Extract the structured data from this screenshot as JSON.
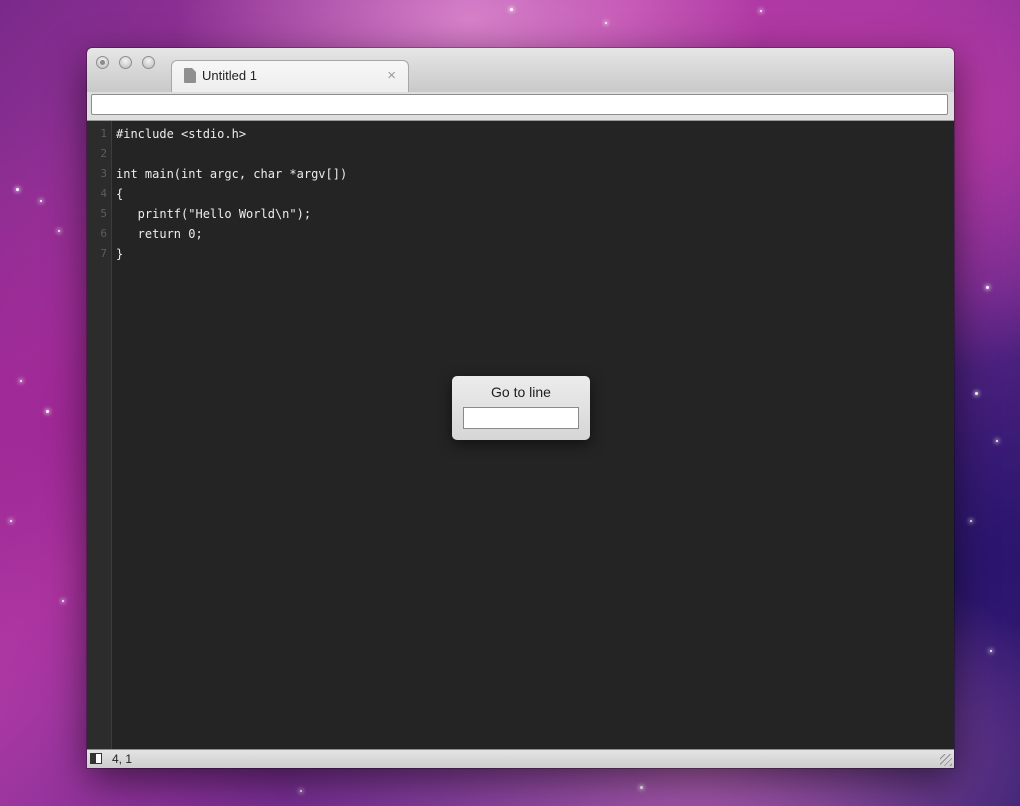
{
  "window": {
    "tab_title": "Untitled 1",
    "tab_close_glyph": "×",
    "path_value": ""
  },
  "editor": {
    "lines": [
      {
        "number": "1",
        "text": "#include <stdio.h>"
      },
      {
        "number": "2",
        "text": ""
      },
      {
        "number": "3",
        "text": "int main(int argc, char *argv[])"
      },
      {
        "number": "4",
        "text": "{"
      },
      {
        "number": "5",
        "text": "   printf(\"Hello World\\n\");"
      },
      {
        "number": "6",
        "text": "   return 0;"
      },
      {
        "number": "7",
        "text": "}"
      }
    ]
  },
  "goto_dialog": {
    "title": "Go to line",
    "input_value": ""
  },
  "statusbar": {
    "position": "4, 1",
    "sidebar_icon": "sidebar-toggle-icon"
  },
  "colors": {
    "editor_bg": "#242424",
    "code_text": "#ececec",
    "gutter_text": "#5d5d5d"
  }
}
